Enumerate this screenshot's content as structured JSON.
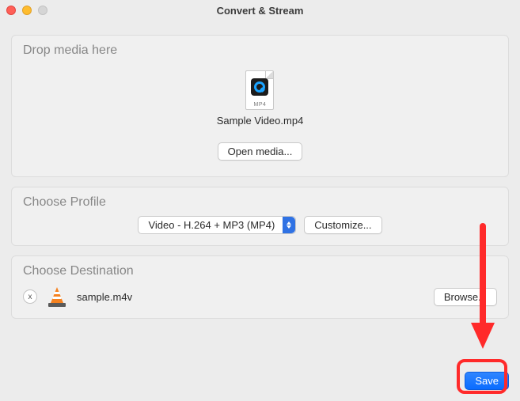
{
  "window": {
    "title": "Convert & Stream"
  },
  "drop": {
    "title": "Drop media here",
    "file_name": "Sample Video.mp4",
    "file_type_label": "MP4",
    "open_button": "Open media..."
  },
  "profile": {
    "title": "Choose Profile",
    "selected": "Video - H.264 + MP3 (MP4)",
    "customize_button": "Customize..."
  },
  "destination": {
    "title": "Choose Destination",
    "file_name": "sample.m4v",
    "browse_button": "Browse...",
    "clear_label": "x"
  },
  "actions": {
    "save": "Save"
  },
  "annotation": {
    "arrow_color": "#ff2a2a",
    "box_color": "#ff2a2a"
  }
}
